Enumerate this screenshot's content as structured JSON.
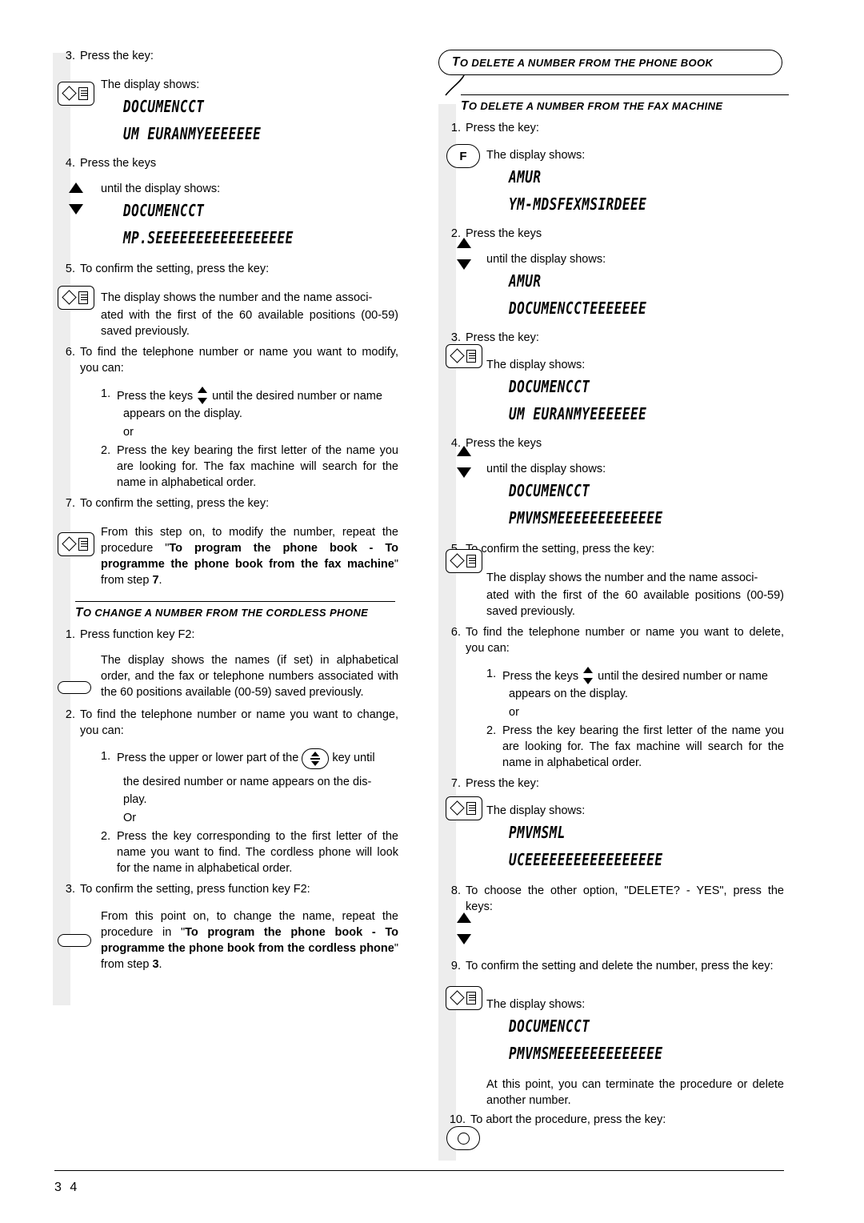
{
  "page": {
    "number": "3 4"
  },
  "callout": {
    "small_start": "T",
    "text": "o delete a number from the phone book"
  },
  "left_column": {
    "steps": [
      {
        "num": "3.",
        "text": "Press the key:"
      },
      {
        "text": "The display shows:"
      }
    ],
    "lcd1_line1": "DOCUMENCCT",
    "lcd1_line2": "UM EURANMYEEEEEEE",
    "step4_num": "4.",
    "step4_text": "Press the keys",
    "step4_sub": "until the display shows:",
    "lcd2_line1": "DOCUMENCCT",
    "lcd2_line2": "MP.SEEEEEEEEEEEEEEEEE",
    "step5_num": "5.",
    "step5_text": "To confirm the setting, press the key:",
    "step5_body": "The display shows the number and the name associ-",
    "step5_body2": "ated with the first of the 60 available positions (00-59) saved previously.",
    "step6_num": "6.",
    "step6_text": "To find the telephone number or name you want to modify, you can:",
    "sub1_num": "1.",
    "sub1_a": "Press the keys",
    "sub1_b": "until the desired number or name",
    "sub1_c": "appears on the display.",
    "or_label": "or",
    "sub2_num": "2.",
    "sub2_text": "Press the key bearing the first letter of the name you are looking for. The fax machine will search for the name in alphabetical order.",
    "step7_num": "7.",
    "step7_text": "To confirm the setting, press the key:",
    "step7_body_a": "From this step on, to modify the number, repeat the procedure \"",
    "step7_body_bold": "To program the phone book - To programme the phone book from the fax machine",
    "step7_body_b": "\" from step ",
    "step7_body_bold2": "7",
    "step7_body_c": ".",
    "section_head_small": "T",
    "section_head": "o change a number from the cordless phone",
    "c1_num": "1.",
    "c1_text": "Press function key F2:",
    "c1_body": "The display shows the names (if set) in alphabetical order, and the fax or telephone numbers associated with the 60 positions available (00-59) saved previously.",
    "c2_num": "2.",
    "c2_text": "To find the telephone number or name you want to change, you can:",
    "c2_sub1_num": "1.",
    "c2_sub1_a": "Press the upper or lower part of the",
    "c2_sub1_b": "key until",
    "c2_sub1_c": "the desired number or name appears on the dis-",
    "c2_sub1_d": "play.",
    "c2_or": "Or",
    "c2_sub2_num": "2.",
    "c2_sub2_text": "Press the key corresponding to the first letter of the name you want to find. The cordless phone will look for the name in alphabetical order.",
    "c3_num": "3.",
    "c3_text": "To confirm the setting, press function key F2:",
    "c3_body_a": "From this point on, to change the name, repeat the procedure in  \"",
    "c3_body_bold": "To program the phone book - To programme the phone book from the cordless phone",
    "c3_body_b": "\" from step ",
    "c3_body_bold2": "3",
    "c3_body_c": "."
  },
  "right_column": {
    "section_head_small": "T",
    "section_head": "o delete a number from the fax machine",
    "r1_num": "1.",
    "r1_text": "Press the key:",
    "r1_body": "The display shows:",
    "lcd1_line1": "AMUR",
    "lcd1_line2": "YM-MDSFEXMSIRDEEE",
    "r2_num": "2.",
    "r2_text": "Press the keys",
    "r2_sub": "until the display shows:",
    "lcd2_line1": "AMUR",
    "lcd2_line2": "DOCUMENCCTEEEEEEE",
    "r3_num": "3.",
    "r3_text": "Press the key:",
    "r3_body": "The display shows:",
    "lcd3_line1": "DOCUMENCCT",
    "lcd3_line2": "UM EURANMYEEEEEEE",
    "r4_num": "4.",
    "r4_text": "Press the keys",
    "r4_sub": "until the display shows:",
    "lcd4_line1": "DOCUMENCCT",
    "lcd4_line2": "PMVMSMEEEEEEEEEEEEE",
    "r5_num": "5.",
    "r5_text": "To confirm the setting, press the key:",
    "r5_body": "The display shows the number and the name associ-",
    "r5_body2": "ated with the first of the 60 available positions (00-59) saved previously.",
    "r6_num": "6.",
    "r6_text": "To find the telephone number or name you want to delete, you can:",
    "r6_sub1_num": "1.",
    "r6_sub1_a": "Press the keys",
    "r6_sub1_b": "until the desired number or name",
    "r6_sub1_c": "appears on the display.",
    "r6_or": "or",
    "r6_sub2_num": "2.",
    "r6_sub2_text": "Press the key bearing the first letter of the name you are looking for. The fax machine will search for the name in alphabetical order.",
    "r7_num": "7.",
    "r7_text": "Press the key:",
    "r7_body": "The display shows:",
    "lcd5_line1": "PMVMSML",
    "lcd5_line2": "UCEEEEEEEEEEEEEEEEE",
    "r8_num": "8.",
    "r8_text": "To choose the other option, \"DELETE? - YES\", press the keys:",
    "r9_num": "9.",
    "r9_text": "To confirm the setting and delete the number, press the key:",
    "r9_body": "The display shows:",
    "lcd6_line1": "DOCUMENCCT",
    "lcd6_line2": "PMVMSMEEEEEEEEEEEEE",
    "r9_after": "At this point, you can terminate the procedure or delete another number.",
    "r10_num": "10.",
    "r10_text": "To abort the procedure, press the key:"
  },
  "icons": {
    "key_confirm": "confirm-key-icon",
    "key_function": "function-key-f-icon",
    "key_stop": "stop-key-icon",
    "arrows": "up-down-arrows-icon",
    "cordless_key": "cordless-softkey-icon",
    "nav_pad": "navigation-pad-icon"
  }
}
